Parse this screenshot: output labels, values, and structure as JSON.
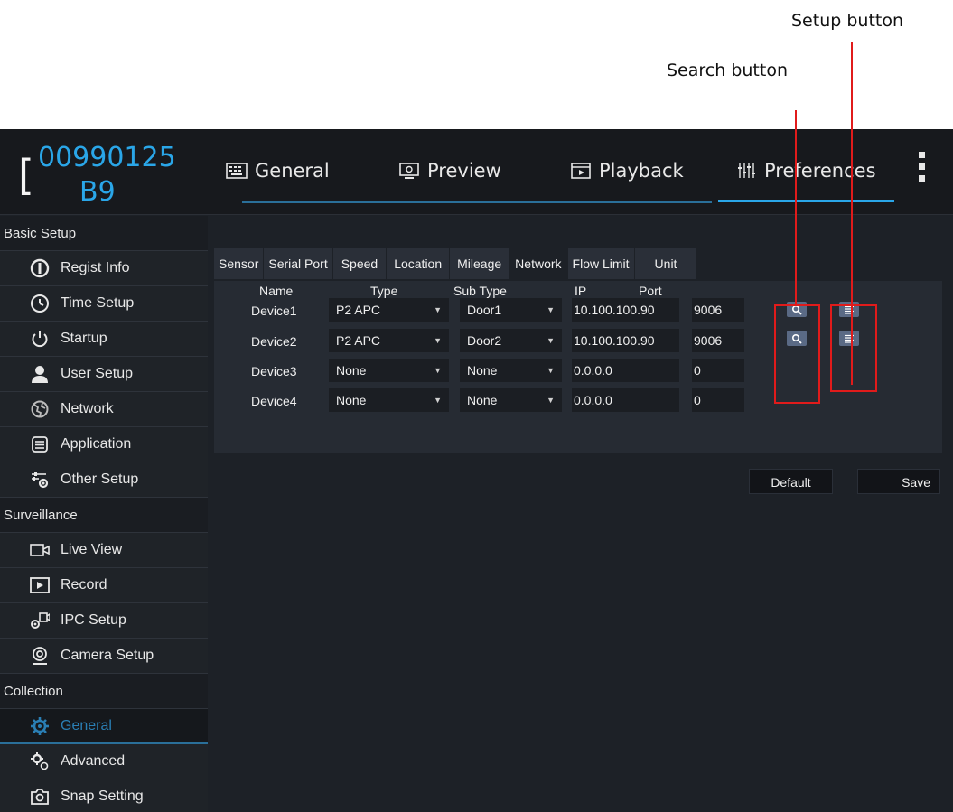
{
  "annotations": {
    "setup_label": "Setup button",
    "search_label": "Search button"
  },
  "device": {
    "id_line1": "00990125",
    "id_line2": "B9"
  },
  "top_tabs": [
    {
      "label": "General",
      "icon": "keyboard-icon"
    },
    {
      "label": "Preview",
      "icon": "monitor-icon"
    },
    {
      "label": "Playback",
      "icon": "film-icon"
    },
    {
      "label": "Preferences",
      "icon": "sliders-icon",
      "selected": true
    }
  ],
  "sidebar": {
    "sections": [
      {
        "title": "Basic Setup",
        "items": [
          {
            "label": "Regist Info",
            "icon": "info-icon"
          },
          {
            "label": "Time Setup",
            "icon": "clock-icon"
          },
          {
            "label": "Startup",
            "icon": "power-icon"
          },
          {
            "label": "User Setup",
            "icon": "user-icon"
          },
          {
            "label": "Network",
            "icon": "globe-icon"
          },
          {
            "label": "Application",
            "icon": "list-icon"
          },
          {
            "label": "Other Setup",
            "icon": "settings-sliders-icon"
          }
        ]
      },
      {
        "title": "Surveillance",
        "items": [
          {
            "label": "Live View",
            "icon": "camera-icon"
          },
          {
            "label": "Record",
            "icon": "record-icon"
          },
          {
            "label": "IPC Setup",
            "icon": "ipc-icon"
          },
          {
            "label": "Camera Setup",
            "icon": "webcam-icon"
          }
        ]
      },
      {
        "title": "Collection",
        "items": [
          {
            "label": "General",
            "icon": "gear-icon",
            "active": true
          },
          {
            "label": "Advanced",
            "icon": "gears-icon"
          },
          {
            "label": "Snap Setting",
            "icon": "snapshot-icon"
          }
        ]
      }
    ]
  },
  "sub_tabs": [
    "Sensor",
    "Serial Port",
    "Speed",
    "Location",
    "Mileage",
    "Network",
    "Flow Limit",
    "Unit"
  ],
  "active_sub_tab": "Network",
  "table": {
    "headers": {
      "name": "Name",
      "type": "Type",
      "sub_type": "Sub Type",
      "ip": "IP",
      "port": "Port"
    },
    "rows": [
      {
        "name": "Device1",
        "type": "P2 APC",
        "sub_type": "Door1",
        "ip": "10.100.100.90",
        "port": "9006",
        "buttons": true
      },
      {
        "name": "Device2",
        "type": "P2 APC",
        "sub_type": "Door2",
        "ip": "10.100.100.90",
        "port": "9006",
        "buttons": true
      },
      {
        "name": "Device3",
        "type": "None",
        "sub_type": "None",
        "ip": "0.0.0.0",
        "port": "0",
        "buttons": false
      },
      {
        "name": "Device4",
        "type": "None",
        "sub_type": "None",
        "ip": "0.0.0.0",
        "port": "0",
        "buttons": false
      }
    ]
  },
  "actions": {
    "default_label": "Default",
    "save_label": "Save"
  },
  "colors": {
    "accent": "#2aa6e8",
    "annotation": "#e01b1b",
    "background": "#1d2127"
  }
}
